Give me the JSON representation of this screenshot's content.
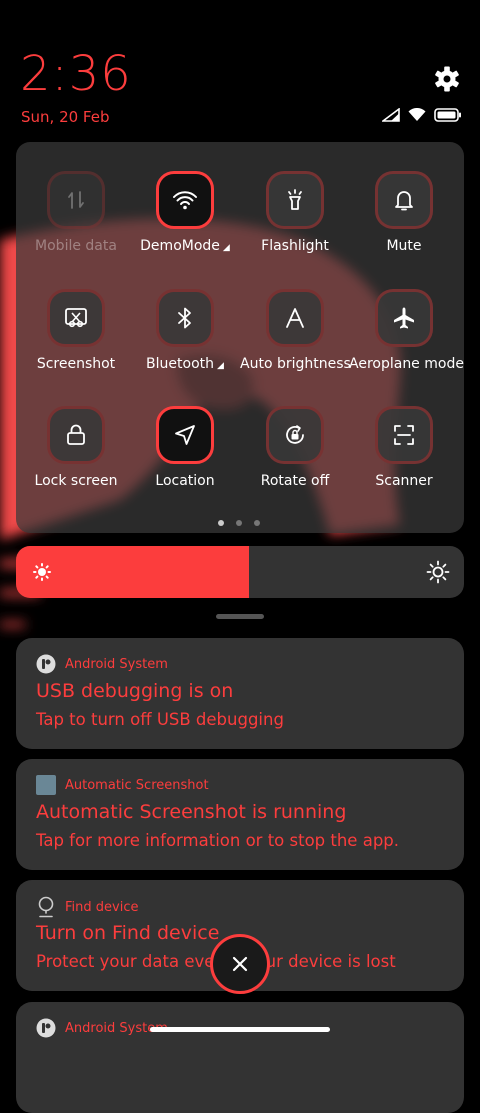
{
  "status": {
    "time": "2:36",
    "date": "Sun, 20 Feb"
  },
  "colors": {
    "accent": "#fc3d3d",
    "panel": "#3a3a3a",
    "card": "#333333"
  },
  "tiles": [
    {
      "label": "Mobile data",
      "icon": "mobile-data-icon",
      "active": false,
      "disabled": true
    },
    {
      "label": "DemoMode",
      "icon": "wifi-icon",
      "active": true,
      "disabled": false
    },
    {
      "label": "Flashlight",
      "icon": "flashlight-icon",
      "active": false,
      "disabled": false
    },
    {
      "label": "Mute",
      "icon": "bell-icon",
      "active": false,
      "disabled": false
    },
    {
      "label": "Screenshot",
      "icon": "screenshot-icon",
      "active": false,
      "disabled": false
    },
    {
      "label": "Bluetooth",
      "icon": "bluetooth-icon",
      "active": false,
      "disabled": false
    },
    {
      "label": "Auto brightness",
      "icon": "auto-brightness-icon",
      "active": false,
      "disabled": false
    },
    {
      "label": "Aeroplane mode",
      "icon": "airplane-icon",
      "active": false,
      "disabled": false
    },
    {
      "label": "Lock screen",
      "icon": "lock-icon",
      "active": false,
      "disabled": false
    },
    {
      "label": "Location",
      "icon": "location-icon",
      "active": true,
      "disabled": false
    },
    {
      "label": "Rotate off",
      "icon": "rotate-lock-icon",
      "active": false,
      "disabled": false
    },
    {
      "label": "Scanner",
      "icon": "scanner-icon",
      "active": false,
      "disabled": false
    }
  ],
  "pager": {
    "pages": 3,
    "current": 1
  },
  "brightness": {
    "level": 0.52
  },
  "notifications": [
    {
      "app": "Android System",
      "title": "USB debugging is on",
      "body": "Tap to turn off USB debugging"
    },
    {
      "app": "Automatic Screenshot",
      "title": "Automatic Screenshot is running",
      "body": "Tap for more information or to stop the app."
    },
    {
      "app": "Find device",
      "title": "Turn on Find device",
      "body": "Protect your data even if your device is lost"
    },
    {
      "app": "Android System",
      "title": "",
      "body": ""
    }
  ]
}
